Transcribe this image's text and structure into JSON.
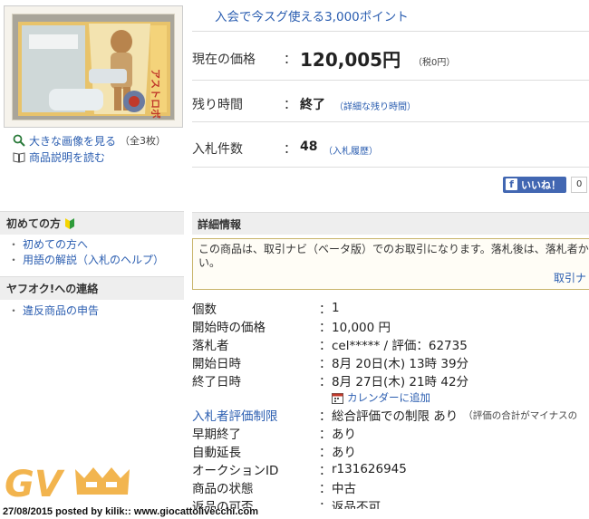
{
  "promo": "入会で今スグ使える3,000ポイント",
  "thumb_text": "アストロボーイ",
  "thumb_links": {
    "large_image": "大きな画像を見る",
    "large_image_count": "（全3枚）",
    "description": "商品説明を読む"
  },
  "summary": {
    "price_label": "現在の価格",
    "colon": "：",
    "price": "120,005円",
    "price_tax": "（税0円）",
    "time_label": "残り時間",
    "time_value": "終了",
    "time_link": "（詳細な残り時間）",
    "bids_label": "入札件数",
    "bids_value": "48",
    "bids_link": "（入札履歴）"
  },
  "facebook": {
    "like": "いいね！",
    "count": "0"
  },
  "sidebar": {
    "beginner_heading": "初めての方",
    "beginner_links": [
      "初めての方へ",
      "用語の解説（入札のヘルプ）"
    ],
    "contact_heading": "ヤフオク!への連絡",
    "contact_links": [
      "違反商品の申告"
    ],
    "bullet": "・"
  },
  "detail": {
    "heading": "詳細情報",
    "notice_line1": "この商品は、取引ナビ（ベータ版）でのお取引になります。落札後は、落札者か",
    "notice_line2": "い。",
    "notice_link": "取引ナ",
    "rows": [
      {
        "label": "個数",
        "value": "1"
      },
      {
        "label": "開始時の価格",
        "value": "10,000 円"
      },
      {
        "label": "落札者",
        "value": "cel***** / 評価：62735"
      },
      {
        "label": "開始日時",
        "value": "8月 20日(木) 13時 39分"
      },
      {
        "label": "終了日時",
        "value": "8月 27日(木) 21時 42分"
      }
    ],
    "calendar_link": "カレンダーに追加",
    "rows2": [
      {
        "label": "入札者評価制限",
        "value": "総合評価での制限 あり",
        "note": "（評価の合計がマイナスの"
      },
      {
        "label": "早期終了",
        "value": "あり"
      },
      {
        "label": "自動延長",
        "value": "あり"
      },
      {
        "label": "オークションID",
        "value": "r131626945"
      },
      {
        "label": "商品の状態",
        "value": "中古"
      },
      {
        "label": "返品の可否",
        "value": "返品不可"
      }
    ],
    "colon": "："
  },
  "watermark": {
    "letters": "GV"
  },
  "footer": "27/08/2015 posted by kilik:: www.giocattolivecchi.com",
  "colors": {
    "link": "#2a5db0",
    "facebook": "#4267b2",
    "watermark": "#f0a830"
  }
}
